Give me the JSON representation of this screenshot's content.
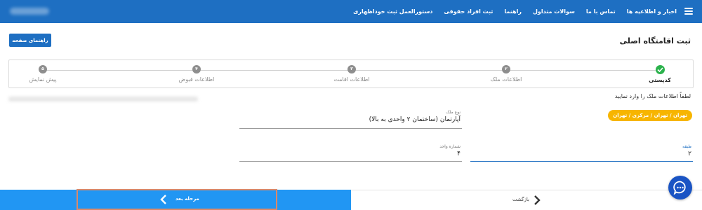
{
  "nav": {
    "items": [
      "اخبار و اطلاعیه ها",
      "تماس با ما",
      "سوالات متداول",
      "راهنما",
      "ثبت افراد حقوقی",
      "دستورالعمل ثبت خوداظهاری"
    ]
  },
  "header": {
    "title": "ثبت اقامتگاه اصلی",
    "guide_button": "راهنمای صفحه"
  },
  "stepper": {
    "steps": [
      {
        "label": "کدپستی",
        "number": "",
        "status": "done"
      },
      {
        "label": "اطلاعات ملک",
        "number": "۲",
        "status": "pending"
      },
      {
        "label": "اطلاعات اقامت",
        "number": "۳",
        "status": "pending"
      },
      {
        "label": "اطلاعات قبوض",
        "number": "۴",
        "status": "pending"
      },
      {
        "label": "پیش نمایش",
        "number": "۵",
        "status": "pending"
      }
    ]
  },
  "form": {
    "prompt": "لطفاً اطلاعات ملک را وارد نمایید",
    "location_badge": "تهران / تهران / مرکزی / تهران",
    "property_type": {
      "label": "نوع ملک",
      "value": "آپارتمان (ساختمان ۲ واحدی به بالا)"
    },
    "floor": {
      "label": "طبقه",
      "value": "۲"
    },
    "unit_number": {
      "label": "شماره واحد",
      "value": "۴"
    }
  },
  "footer": {
    "next_label": "مرحله بعد",
    "back_label": "بازگشت"
  },
  "colors": {
    "primary": "#1e6fc2",
    "next_button": "#2196f3",
    "badge": "#f7b500",
    "done": "#2bb24c"
  }
}
